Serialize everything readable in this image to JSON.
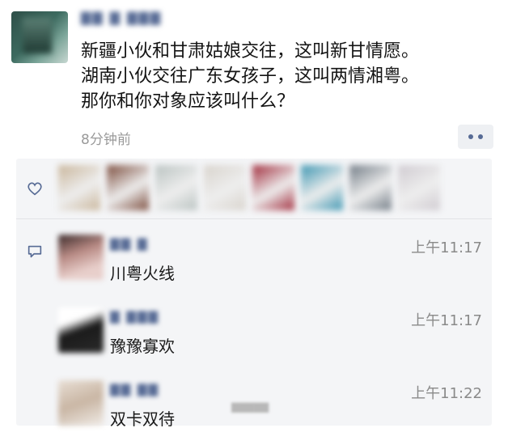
{
  "post": {
    "author": "▇▇ ▇ ▇▇▇",
    "lines": [
      "新疆小伙和甘肃姑娘交往，这叫新甘情愿。",
      "湖南小伙交往广东女孩子，这叫两情湘粤。",
      "那你和你对象应该叫什么？"
    ],
    "time": "8分钟前"
  },
  "likes": {
    "icon": "heart-icon",
    "avatar_colors": [
      "#c9b59a",
      "#7a4a3a",
      "#b9c2c0",
      "#d8d3cc",
      "#a02a3a",
      "#3a94b0",
      "#707a84",
      "#cfcad0"
    ]
  },
  "comments": [
    {
      "name": "▇▇ ▇",
      "time": "上午11:17",
      "text": "川粤火线",
      "avatar": "#caa9a6"
    },
    {
      "name": "▇ ▇▇▇",
      "time": "上午11:17",
      "text": "豫豫寡欢",
      "avatar": "#2b2b2b"
    },
    {
      "name": "▇▇ ▇▇",
      "time": "上午11:22",
      "text": "双卡双待",
      "avatar": "#d6c8b8"
    }
  ],
  "colors": {
    "link": "#576b95",
    "panel": "#f4f5f7",
    "muted": "#9a9a9a"
  }
}
